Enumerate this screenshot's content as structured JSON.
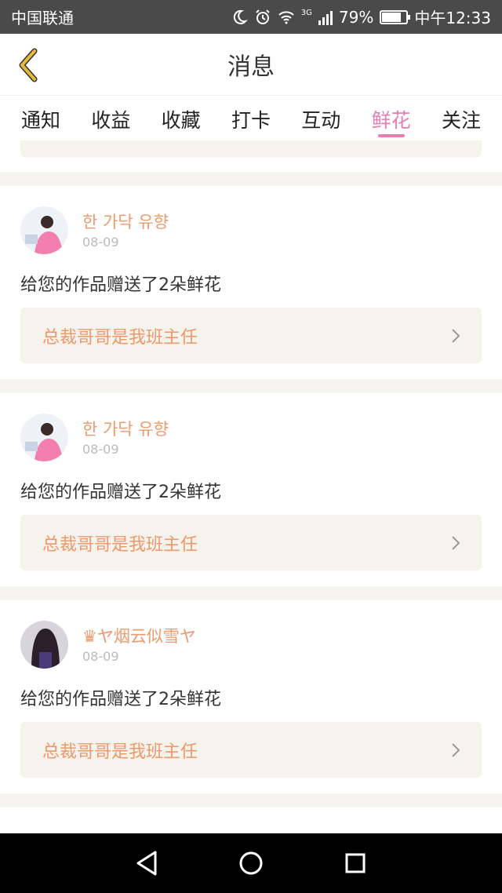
{
  "status_bar": {
    "carrier": "中国联通",
    "network": "3G",
    "battery_percent": "79%",
    "battery_level": 0.79,
    "time": "中午12:33",
    "icons": [
      "moon-icon",
      "alarm-icon",
      "wifi-icon",
      "signal-icon",
      "battery-icon"
    ]
  },
  "header": {
    "title": "消息",
    "back_icon": "chevron-left-icon"
  },
  "tabs": [
    {
      "label": "通知"
    },
    {
      "label": "收益"
    },
    {
      "label": "收藏"
    },
    {
      "label": "打卡"
    },
    {
      "label": "互动"
    },
    {
      "label": "鲜花",
      "active": true
    },
    {
      "label": "关注"
    }
  ],
  "messages": [
    {
      "user": "한 가닥 유향",
      "date": "08-09",
      "text": "给您的作品赠送了2朵鲜花",
      "work_title": "总裁哥哥是我班主任"
    },
    {
      "user": "한 가닥 유향",
      "date": "08-09",
      "text": "给您的作品赠送了2朵鲜花",
      "work_title": "总裁哥哥是我班主任"
    },
    {
      "user": "♛ヤ烟云似雪ヤ",
      "date": "08-09",
      "text": "给您的作品赠送了2朵鲜花",
      "work_title": "总裁哥哥是我班主任"
    }
  ],
  "colors": {
    "accent_pink": "#e27fb4",
    "accent_orange": "#ec9a6c",
    "back_icon": "#e6b93a"
  },
  "nav_bar": {
    "icons": [
      "back-triangle-icon",
      "home-circle-icon",
      "recents-square-icon"
    ]
  }
}
